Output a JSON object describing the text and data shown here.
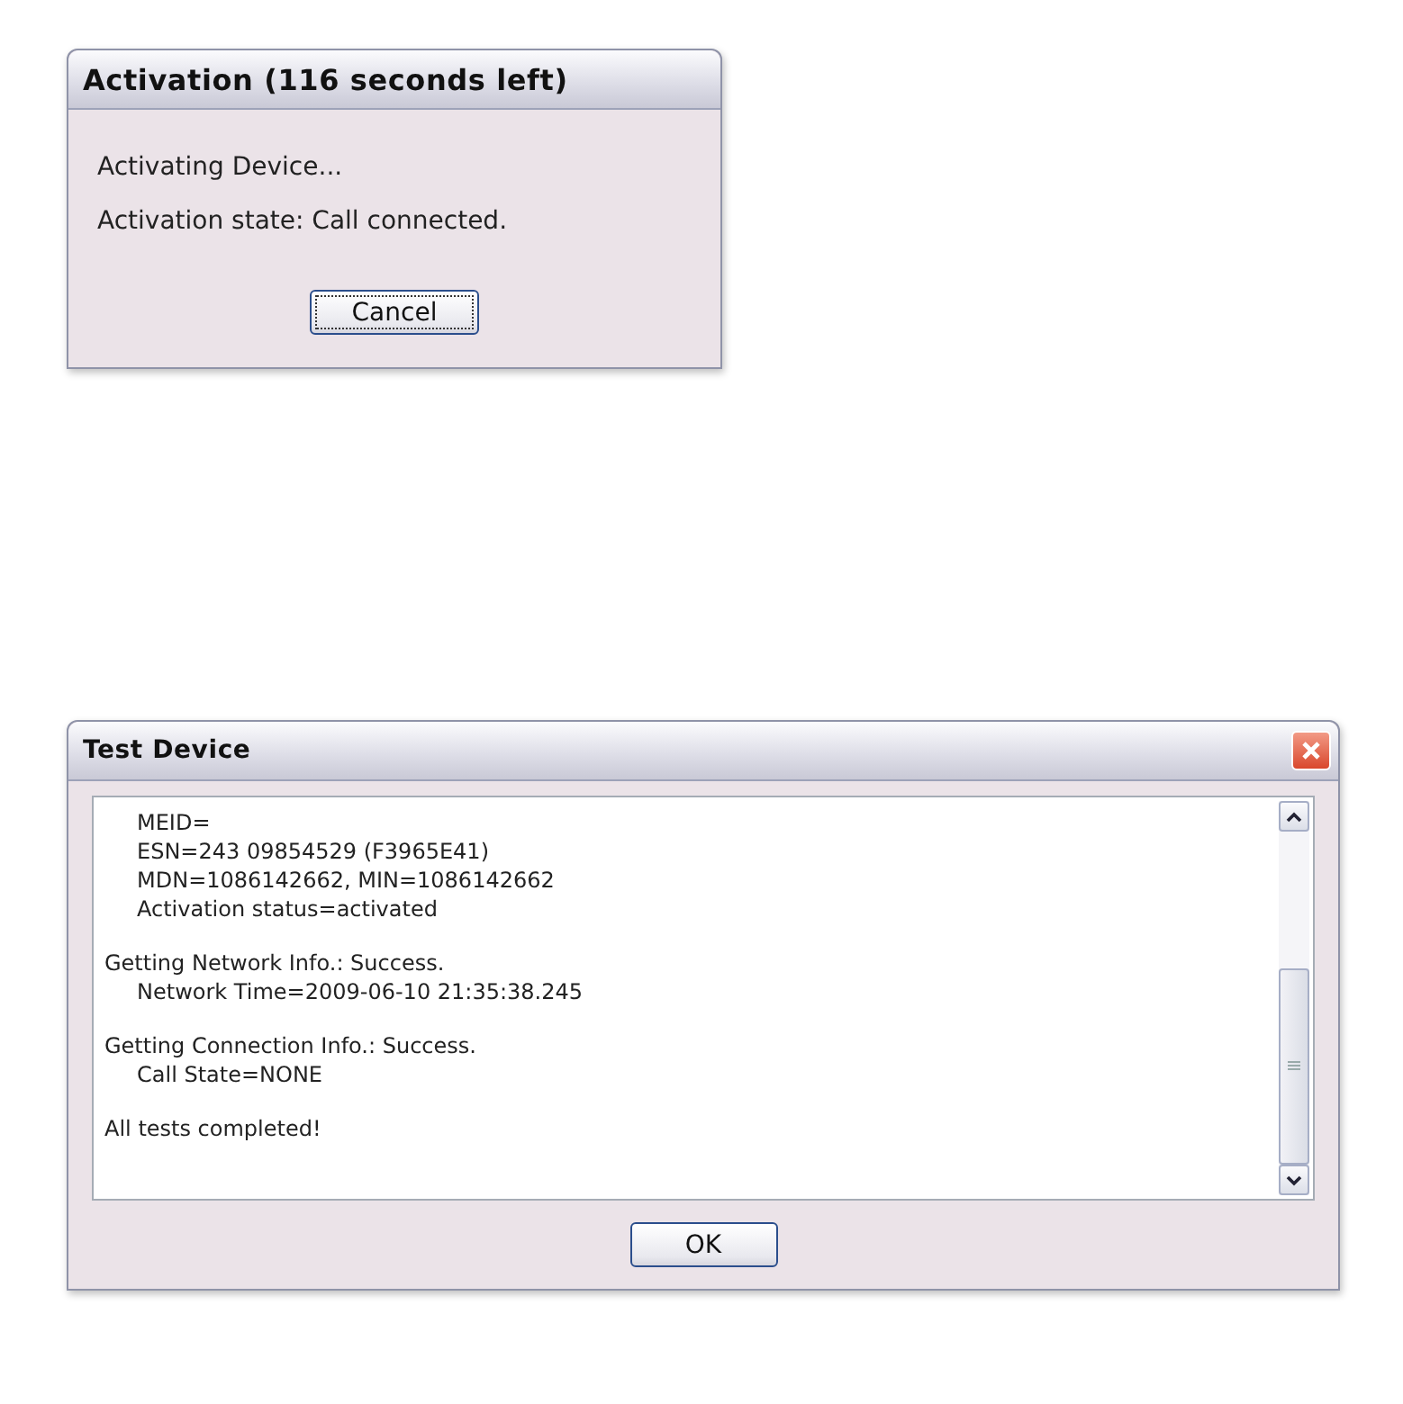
{
  "dialogs": [
    {
      "kind": "progress",
      "title": "Activation (116 seconds left)",
      "lines": [
        "Activating Device...",
        "Activation state: Call connected."
      ],
      "button": "Cancel",
      "closable": false
    },
    {
      "kind": "log",
      "title": "Test Device",
      "log": [
        {
          "children": [
            {
              "text": "MEID="
            },
            {
              "text": "ESN=243 09854529 (F3965E41)"
            },
            {
              "text": "MDN=1086142662, MIN=1086142662"
            },
            {
              "text": "Activation status=activated"
            }
          ]
        },
        {
          "text": "Getting Network Info.: Success.",
          "children": [
            {
              "text": "Network Time=2009-06-10 21:35:38.245"
            }
          ]
        },
        {
          "text": "Getting Connection Info.: Success.",
          "children": [
            {
              "text": "Call State=NONE"
            }
          ]
        },
        {
          "text": "All tests completed!"
        }
      ],
      "button": "OK",
      "closable": true
    }
  ]
}
